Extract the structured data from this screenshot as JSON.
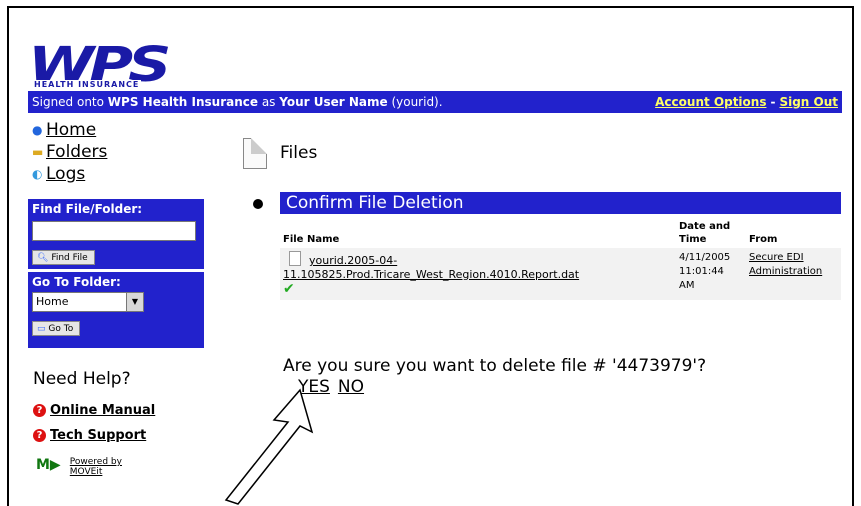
{
  "logo": {
    "main": "WPS",
    "sub": "HEALTH INSURANCE"
  },
  "topbar": {
    "signed_prefix": "Signed onto ",
    "org": "WPS Health Insurance",
    "as": " as ",
    "user": "Your User Name",
    "userid": " (yourid).",
    "account_options": "Account Options",
    "separator": "-",
    "sign_out": "Sign Out"
  },
  "nav": [
    {
      "label": "Home",
      "icon": "globe-icon"
    },
    {
      "label": "Folders",
      "icon": "folder-icon"
    },
    {
      "label": "Logs",
      "icon": "logs-icon"
    }
  ],
  "find": {
    "title": "Find File/Folder:",
    "value": "",
    "button": "Find File"
  },
  "goto": {
    "title": "Go To Folder:",
    "selected": "Home",
    "button": "Go To"
  },
  "help": {
    "title": "Need Help?",
    "links": [
      "Online Manual",
      "Tech Support"
    ],
    "powered": [
      "Powered by",
      "MOVEit"
    ]
  },
  "main": {
    "title": "Files",
    "confirm_title": "Confirm File Deletion",
    "columns": [
      "File Name",
      "Date and Time",
      "From"
    ],
    "file": {
      "name_line1": "yourid.2005-04-",
      "name_line2": "11.105825.Prod.Tricare_West_Region.4010.Report.dat",
      "date_line1": "4/11/2005",
      "date_line2": "11:01:44",
      "date_line3": "AM",
      "from_line1": "Secure EDI",
      "from_line2": "Administration"
    },
    "question": "Are you sure you want to delete file # '4473979'?",
    "yes": "YES",
    "no": "NO"
  },
  "colors": {
    "bar": "#2222cc",
    "link_yellow": "#ffff66",
    "logo": "#1a1aa6"
  }
}
